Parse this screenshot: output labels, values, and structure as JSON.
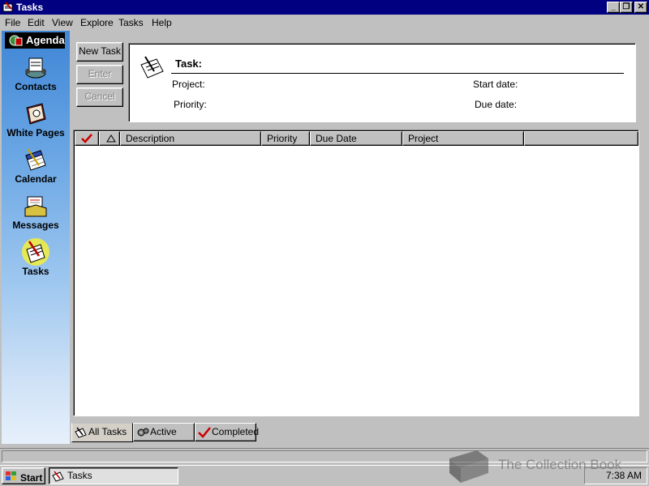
{
  "window": {
    "title": "Tasks"
  },
  "menu": [
    "File",
    "Edit",
    "View",
    "Explore",
    "Tasks",
    "Help"
  ],
  "sidebar": {
    "agenda_label": "Agenda",
    "items": [
      {
        "label": "Contacts",
        "icon": "rolodex-icon"
      },
      {
        "label": "White Pages",
        "icon": "phonebook-icon"
      },
      {
        "label": "Calendar",
        "icon": "calendar-icon"
      },
      {
        "label": "Messages",
        "icon": "messages-icon"
      },
      {
        "label": "Tasks",
        "icon": "tasks-icon",
        "selected": true
      }
    ]
  },
  "toolbar": {
    "new_task": "New Task",
    "enter": "Enter",
    "cancel": "Cancel"
  },
  "form": {
    "task_label": "Task:",
    "project_label": "Project:",
    "priority_label": "Priority:",
    "start_date_label": "Start date:",
    "due_date_label": "Due date:"
  },
  "list": {
    "columns": [
      "Description",
      "Priority",
      "Due Date",
      "Project"
    ],
    "rows": []
  },
  "tabs": [
    {
      "label": "All Tasks",
      "active": true
    },
    {
      "label": "Active",
      "active": false
    },
    {
      "label": "Completed",
      "active": false
    }
  ],
  "taskbar": {
    "start_label": "Start",
    "task_button": "Tasks",
    "clock": "7:38 AM"
  },
  "watermark": "The Collection Book",
  "colors": {
    "titlebar": "#000080",
    "face": "#c0c0c0",
    "check": "#cc0000"
  }
}
